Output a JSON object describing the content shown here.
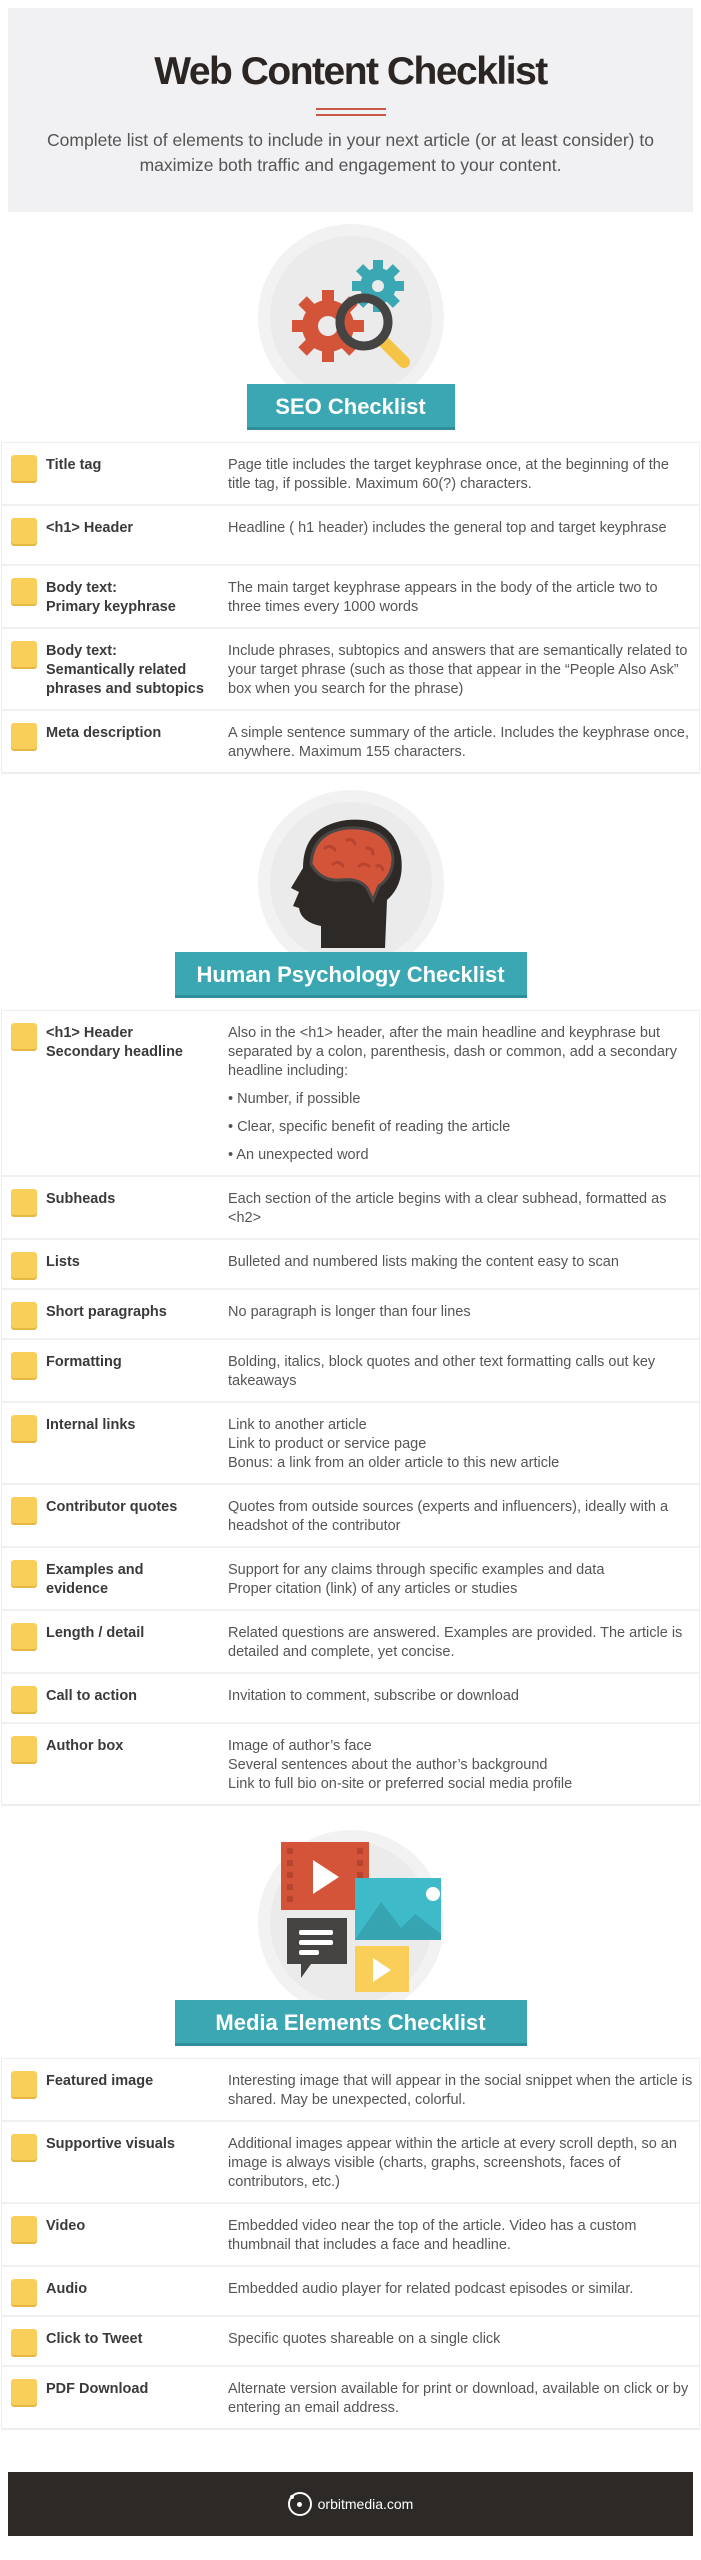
{
  "hero": {
    "title": "Web Content Checklist",
    "subtitle": "Complete list of elements to include in your next article (or at least consider) to maximize both traffic and engagement to your content."
  },
  "colors": {
    "accent_teal": "#3aa7b3",
    "checkbox_yellow": "#f9cf5a",
    "accent_red": "#c8594a",
    "footer_dark": "#2d2926"
  },
  "sections": [
    {
      "title": "SEO Checklist",
      "icon": "gears-magnifier-icon",
      "items": [
        {
          "label": [
            "Title tag"
          ],
          "desc": [
            "Page title includes the target keyphrase once, at the beginning of the title tag, if possible. Maximum 60(?) characters."
          ]
        },
        {
          "label": [
            "<h1> Header"
          ],
          "desc": [
            "Headline ( h1 header) includes the general top and target keyphrase"
          ]
        },
        {
          "label": [
            "Body text:",
            "Primary keyphrase"
          ],
          "desc": [
            "The main target keyphrase appears in the body of the article two to three times every 1000 words"
          ]
        },
        {
          "label": [
            "Body text:",
            "Semantically related",
            "phrases and subtopics"
          ],
          "desc": [
            "Include phrases, subtopics and answers that are semantically related to your target phrase (such as those that appear in the “People Also Ask” box when you search for the phrase)"
          ]
        },
        {
          "label": [
            "Meta description"
          ],
          "desc": [
            "A simple sentence summary of the article. Includes the keyphrase once, anywhere. Maximum 155 characters."
          ]
        }
      ]
    },
    {
      "title": "Human Psychology Checklist",
      "icon": "head-brain-icon",
      "items": [
        {
          "label": [
            "<h1> Header",
            "Secondary headline"
          ],
          "desc": [
            "Also in the <h1> header, after the main headline and keyphrase but separated by a colon, parenthesis, dash or common, add a secondary headline including:"
          ],
          "bullets": [
            "• Number, if possible",
            "• Clear, specific benefit of reading the article",
            "• An unexpected word"
          ]
        },
        {
          "label": [
            "Subheads"
          ],
          "desc": [
            "Each section of the article begins with a clear subhead, formatted as <h2>"
          ]
        },
        {
          "label": [
            "Lists"
          ],
          "desc": [
            "Bulleted and numbered lists making the content easy to scan"
          ]
        },
        {
          "label": [
            "Short paragraphs"
          ],
          "desc": [
            "No paragraph is longer than four lines"
          ]
        },
        {
          "label": [
            "Formatting"
          ],
          "desc": [
            "Bolding, italics, block quotes and other text formatting calls out key takeaways"
          ]
        },
        {
          "label": [
            "Internal links"
          ],
          "desc": [
            "Link to another article",
            "Link to product or service page",
            "Bonus: a link from an older article to this new article"
          ]
        },
        {
          "label": [
            "Contributor quotes"
          ],
          "desc": [
            "Quotes from outside sources (experts and influencers), ideally with a headshot of the contributor"
          ]
        },
        {
          "label": [
            "Examples and",
            "evidence"
          ],
          "desc": [
            "Support for any claims through specific examples and data",
            "Proper citation (link) of any articles or studies"
          ]
        },
        {
          "label": [
            "Length / detail"
          ],
          "desc": [
            "Related questions are answered. Examples are provided. The article is detailed and complete, yet concise."
          ]
        },
        {
          "label": [
            "Call to action"
          ],
          "desc": [
            "Invitation to comment, subscribe or download"
          ]
        },
        {
          "label": [
            "Author box"
          ],
          "desc": [
            "Image of author’s face",
            "Several sentences about the author’s background",
            "Link to full bio on-site or preferred social media profile"
          ]
        }
      ]
    },
    {
      "title": "Media Elements Checklist",
      "icon": "media-collage-icon",
      "items": [
        {
          "label": [
            "Featured image"
          ],
          "desc": [
            "Interesting image that will appear in the social snippet when the article is shared. May be unexpected, colorful."
          ]
        },
        {
          "label": [
            "Supportive visuals"
          ],
          "desc": [
            "Additional images appear within the article at every scroll depth, so an image is always visible (charts, graphs, screenshots, faces of contributors, etc.)"
          ]
        },
        {
          "label": [
            "Video"
          ],
          "desc": [
            "Embedded video near the top of the article. Video has a custom thumbnail that includes a face and headline."
          ]
        },
        {
          "label": [
            "Audio"
          ],
          "desc": [
            "Embedded audio player for related podcast episodes or similar."
          ]
        },
        {
          "label": [
            "Click to Tweet"
          ],
          "desc": [
            "Specific quotes shareable on a single click"
          ]
        },
        {
          "label": [
            "PDF Download"
          ],
          "desc": [
            "Alternate version available for print or download, available on click or by entering an email address."
          ]
        }
      ]
    }
  ],
  "footer": {
    "site": "orbitmedia.com",
    "logo_icon": "orbit-logo-icon"
  }
}
